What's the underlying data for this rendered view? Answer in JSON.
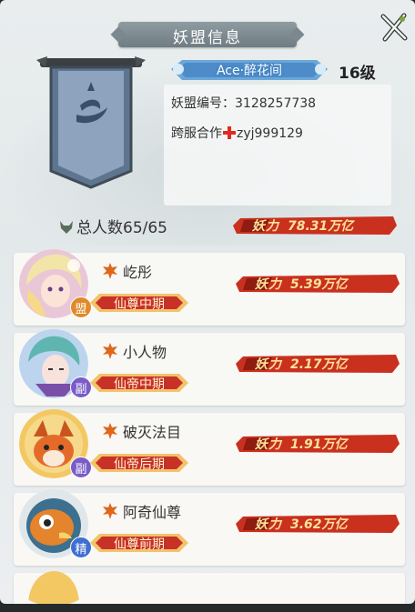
{
  "header": {
    "title": "妖盟信息"
  },
  "alliance": {
    "name": "Ace·醉花间",
    "level": "16级",
    "id_label": "妖盟编号：",
    "id_value": "3128257738",
    "cross_label": "跨服合作",
    "cross_value": "zyj999129",
    "total_label": "总人数",
    "total_value": "65/65",
    "power_label": "妖力",
    "power_value": "78.31万亿"
  },
  "members": [
    {
      "name": "屹彤",
      "role": "盟",
      "rank": "仙尊中期",
      "power_label": "妖力",
      "power": "5.39万亿",
      "role_color": "#e08a2a"
    },
    {
      "name": "小人物",
      "role": "副",
      "rank": "仙帝中期",
      "power_label": "妖力",
      "power": "2.17万亿",
      "role_color": "#7a5cc8"
    },
    {
      "name": "破灭法目",
      "role": "副",
      "rank": "仙帝后期",
      "power_label": "妖力",
      "power": "1.91万亿",
      "role_color": "#7a5cc8"
    },
    {
      "name": "阿奇仙尊",
      "role": "精",
      "rank": "仙尊前期",
      "power_label": "妖力",
      "power": "3.62万亿",
      "role_color": "#3f6fd0"
    }
  ],
  "colors": {
    "power_red": "#c9301e",
    "rank_red": "#c83226",
    "flag_blue": "#7d93b0"
  }
}
